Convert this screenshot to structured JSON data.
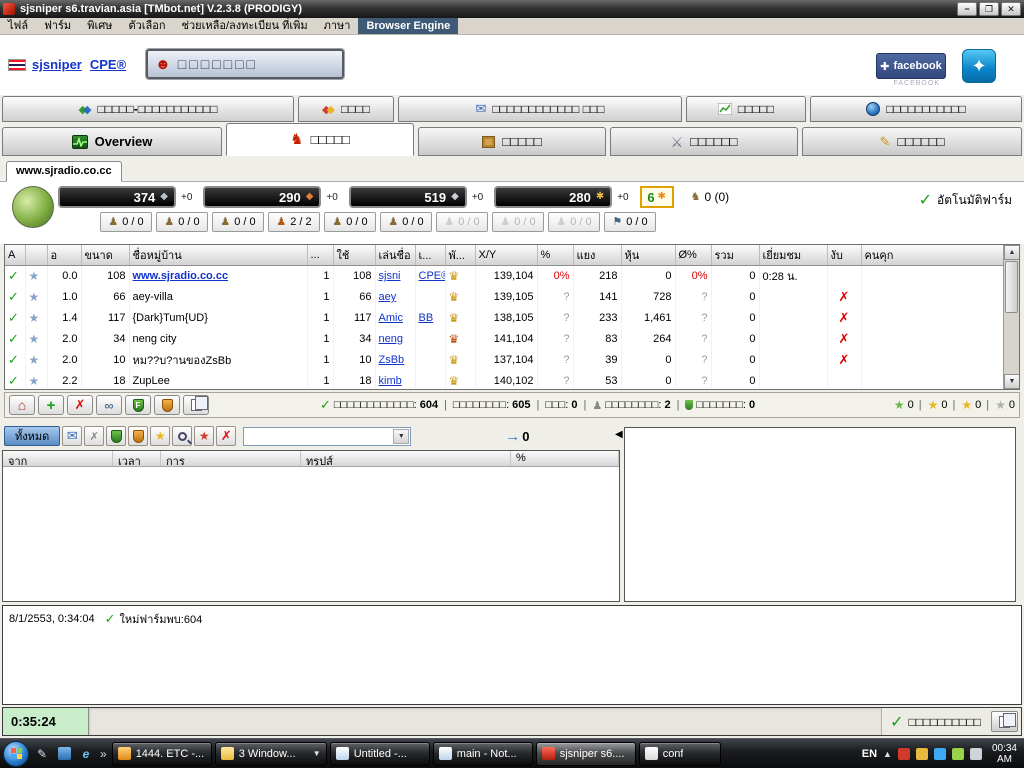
{
  "window": {
    "title": "sjsniper s6.travian.asia [TMbot.net] V.2.3.8 (PRODIGY)",
    "minimize": "−",
    "maximize": "❐",
    "close": "✕"
  },
  "menu": {
    "items": {
      "file": "ไฟล์",
      "farm": "ฟาร์ม",
      "special": "พิเศษ",
      "options": "ตัวเลือก",
      "help": "ช่วยเหลือ/ลงทะเบียน ที่เพิ่ม",
      "language": "ภาษา",
      "browser_engine": "Browser Engine"
    }
  },
  "header": {
    "account": "sjsniper",
    "alliance": "CPE®",
    "progress_boxes": "□□□□□□□",
    "facebook": "facebook",
    "facebook_caption": "FACEBOOK"
  },
  "tabs_row1": {
    "t0": "□□□□□-□□□□□□□□□□□",
    "t1": "□□□□",
    "t2": "□□□□□□□□□□□□ □□□",
    "t3": "□□□□□",
    "t4": "□□□□□□□□□□□"
  },
  "tabs_row2": {
    "t0": "Overview",
    "t1": "□□□□□",
    "t2": "□□□□□",
    "t3": "□□□□□□",
    "t4": "□□□□□□"
  },
  "village_tab": "www.sjradio.co.cc",
  "resources": {
    "wood": "374",
    "wood_d": "+0",
    "clay": "290",
    "clay_d": "+0",
    "iron": "519",
    "iron_d": "+0",
    "crop": "280",
    "crop_d": "+0",
    "free_crop": "6",
    "movements": "0 (0)",
    "autofarm": "อัตโนมัติฟาร์ม"
  },
  "troops": {
    "values": [
      "0 / 0",
      "0 / 0",
      "0 / 0",
      "2 / 2",
      "0 / 0",
      "0 / 0",
      "0 / 0",
      "0 / 0",
      "0 / 0",
      "0 / 0"
    ]
  },
  "farm_table": {
    "col_a": "A",
    "col_dist": "อ",
    "col_size": "ขนาด",
    "col_name": "ชื่อหมู่บ้าน",
    "col_dots": "...",
    "col_use": "ใช้",
    "col_player": "เล่นชื่อ",
    "col_ally": "เ...",
    "col_tribe": "พั...",
    "col_xy": "X/Y",
    "col_pct": "%",
    "col_raid": "แยง",
    "col_cap": "หุ้น",
    "col_pct2": "Ø%",
    "col_total": "รวม",
    "col_visit": "เยี่ยมชม",
    "col_bite": "งับ",
    "col_jail": "คนคุก",
    "rows": [
      {
        "dist": "0.0",
        "size": "108",
        "name": "www.sjradio.co.cc",
        "c1": "1",
        "c2": "108",
        "player": "sjsni",
        "ally": "CPE®",
        "xy": "139,104",
        "pct": "0%",
        "raid": "218",
        "cap": "0",
        "pct2": "0%",
        "total": "0",
        "visit": "0:28 น.",
        "bite": ""
      },
      {
        "dist": "1.0",
        "size": "66",
        "name": "aey-villa",
        "c1": "1",
        "c2": "66",
        "player": "aey",
        "ally": "",
        "xy": "139,105",
        "pct": "?",
        "raid": "141",
        "cap": "728",
        "pct2": "?",
        "total": "0",
        "visit": "",
        "bite": "✗"
      },
      {
        "dist": "1.4",
        "size": "117",
        "name": "{Dark}Tum{UD}",
        "c1": "1",
        "c2": "117",
        "player": "Amic",
        "ally": "BB",
        "xy": "138,105",
        "pct": "?",
        "raid": "233",
        "cap": "1,461",
        "pct2": "?",
        "total": "0",
        "visit": "",
        "bite": "✗"
      },
      {
        "dist": "2.0",
        "size": "34",
        "name": "neng city",
        "c1": "1",
        "c2": "34",
        "player": "neng",
        "ally": "",
        "xy": "141,104",
        "pct": "?",
        "raid": "83",
        "cap": "264",
        "pct2": "?",
        "total": "0",
        "visit": "",
        "bite": "✗"
      },
      {
        "dist": "2.0",
        "size": "10",
        "name": "หม??บ?านของZsBb",
        "c1": "1",
        "c2": "10",
        "player": "ZsBb",
        "ally": "",
        "xy": "137,104",
        "pct": "?",
        "raid": "39",
        "cap": "0",
        "pct2": "?",
        "total": "0",
        "visit": "",
        "bite": "✗"
      },
      {
        "dist": "2.2",
        "size": "18",
        "name": "ZupLee",
        "c1": "1",
        "c2": "18",
        "player": "kimb",
        "ally": "",
        "xy": "140,102",
        "pct": "?",
        "raid": "53",
        "cap": "0",
        "pct2": "?",
        "total": "0",
        "visit": "",
        "bite": ""
      }
    ]
  },
  "status": {
    "s1_label": "□□□□□□□□□□□□:",
    "s1_value": "604",
    "s2_label": "□□□□□□□□:",
    "s2_value": "605",
    "s3_label": "□□□:",
    "s3_value": "0",
    "s4_label": "□□□□□□□□:",
    "s4_value": "2",
    "s5_label": "□□□□□□□:",
    "s5_value": "0",
    "star1": "0",
    "star2": "0",
    "star3": "0",
    "star4": "0"
  },
  "filter_panel": {
    "all_button": "ทั้งหมด",
    "count": "0",
    "col_from": "จาก",
    "col_time": "เวลา",
    "col_action": "การ",
    "col_troops": "ทรูปส์",
    "col_pct": "%"
  },
  "log": {
    "timestamp": "8/1/2553, 0:34:04",
    "message": "ใหม่ฟาร์มพบ:604"
  },
  "bottom_bar": {
    "timer": "0:35:24",
    "right_text": "□□□□□□□□□□"
  },
  "taskbar": {
    "buttons": {
      "b0": "1444. ETC -...",
      "b1": "3 Window...",
      "b2": "Untitled -...",
      "b3": "main - Not...",
      "b4": "sjsniper s6....",
      "b5": "conf"
    },
    "tray_lang": "EN",
    "clock_time": "00:34",
    "clock_ampm": "AM"
  },
  "icons": {
    "check": "✓",
    "x": "✗",
    "star": "★",
    "crown": "♛",
    "house": "⌂",
    "plus": "+",
    "chain": "∞",
    "envelope": "✉",
    "dropdown": "▼",
    "up": "▲",
    "down": "▼",
    "left_arrow": "◀",
    "chevrons": "»",
    "knight": "♞",
    "devil": "☻",
    "sun": "✱",
    "flag": "⚑",
    "swords": "⚔",
    "pencil": "✎",
    "pawn": "♟",
    "diamond": "◆",
    "arrow_right": "→",
    "msn": "✦",
    "thumb": "✚",
    "e": "e"
  }
}
